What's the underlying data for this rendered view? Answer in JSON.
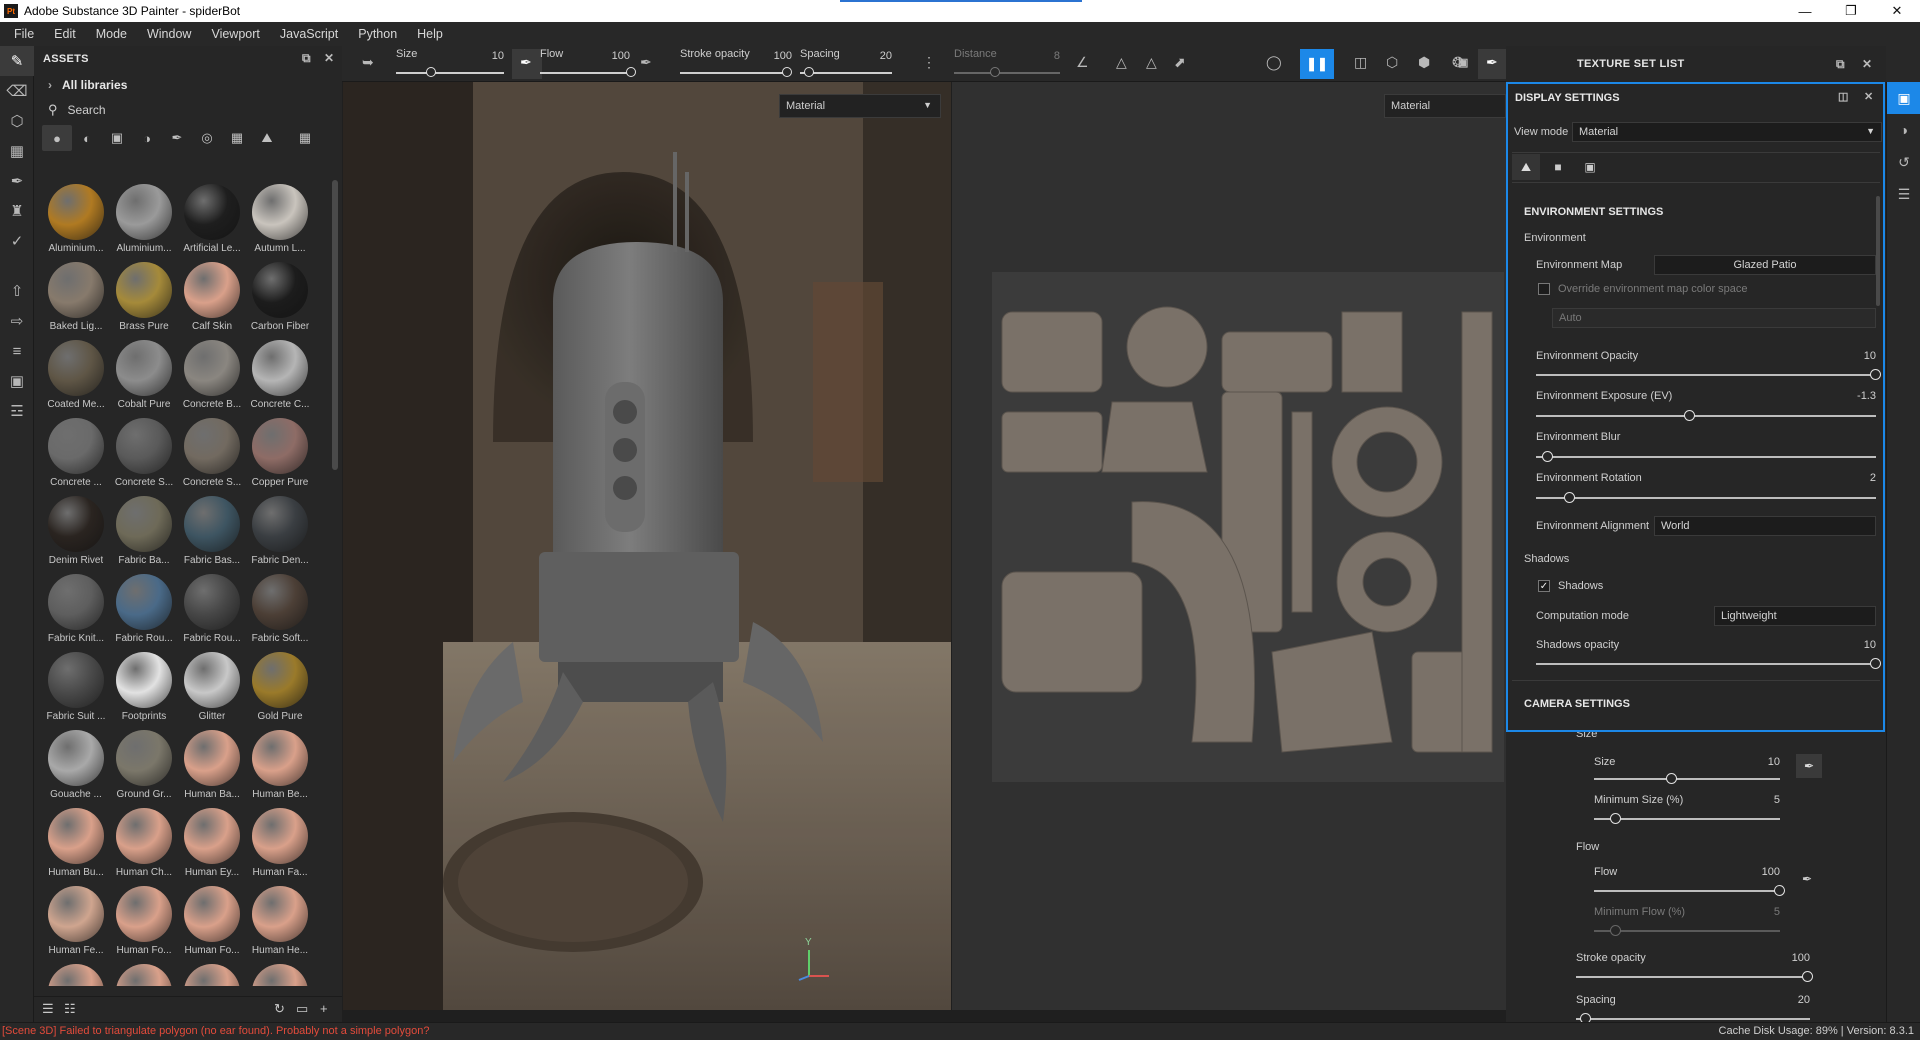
{
  "app": {
    "title": "Adobe Substance 3D Painter - spiderBot",
    "logo_text": "Pt"
  },
  "menu": [
    "File",
    "Edit",
    "Mode",
    "Window",
    "Viewport",
    "JavaScript",
    "Python",
    "Help"
  ],
  "assets": {
    "header": "ASSETS",
    "libraries_label": "All libraries",
    "search_placeholder": "Search",
    "items": [
      {
        "label": "Aluminium...",
        "color": "#b07a22"
      },
      {
        "label": "Aluminium...",
        "color": "#9a9a9a"
      },
      {
        "label": "Artificial Le...",
        "color": "#1e1e1e"
      },
      {
        "label": "Autumn L...",
        "color": "#c9c4bd"
      },
      {
        "label": "Baked Lig...",
        "color": "#877a6c"
      },
      {
        "label": "Brass Pure",
        "color": "#a58a3a"
      },
      {
        "label": "Calf Skin",
        "color": "#d9a08a"
      },
      {
        "label": "Carbon Fiber",
        "color": "#1c1c1c"
      },
      {
        "label": "Coated Me...",
        "color": "#5f5646"
      },
      {
        "label": "Cobalt Pure",
        "color": "#8c8c8c"
      },
      {
        "label": "Concrete B...",
        "color": "#8a8680"
      },
      {
        "label": "Concrete C...",
        "color": "#b5b5b5"
      },
      {
        "label": "Concrete ...",
        "color": "#6a6a6a"
      },
      {
        "label": "Concrete S...",
        "color": "#5a5a5a"
      },
      {
        "label": "Concrete S...",
        "color": "#726a60"
      },
      {
        "label": "Copper Pure",
        "color": "#8e6c66"
      },
      {
        "label": "Denim Rivet",
        "color": "#2a2420"
      },
      {
        "label": "Fabric Ba...",
        "color": "#6e6a58"
      },
      {
        "label": "Fabric Bas...",
        "color": "#3e5562"
      },
      {
        "label": "Fabric Den...",
        "color": "#3a3e42"
      },
      {
        "label": "Fabric Knit...",
        "color": "#5e5e5e"
      },
      {
        "label": "Fabric Rou...",
        "color": "#4a6a88"
      },
      {
        "label": "Fabric Rou...",
        "color": "#474747"
      },
      {
        "label": "Fabric Soft...",
        "color": "#4c3f36"
      },
      {
        "label": "Fabric Suit ...",
        "color": "#4a4a4a"
      },
      {
        "label": "Footprints",
        "color": "#e2e2e2"
      },
      {
        "label": "Glitter",
        "color": "#c8c8c8"
      },
      {
        "label": "Gold Pure",
        "color": "#9a7a2a"
      },
      {
        "label": "Gouache ...",
        "color": "#a9a9a9"
      },
      {
        "label": "Ground Gr...",
        "color": "#7b776a"
      },
      {
        "label": "Human Ba...",
        "color": "#d9a08a"
      },
      {
        "label": "Human Be...",
        "color": "#d9a08a"
      },
      {
        "label": "Human Bu...",
        "color": "#d9a08a"
      },
      {
        "label": "Human Ch...",
        "color": "#d9a08a"
      },
      {
        "label": "Human Ey...",
        "color": "#d9a08a"
      },
      {
        "label": "Human Fa...",
        "color": "#d9a08a"
      },
      {
        "label": "Human Fe...",
        "color": "#cfa58f"
      },
      {
        "label": "Human Fo...",
        "color": "#d9a08a"
      },
      {
        "label": "Human Fo...",
        "color": "#d9a08a"
      },
      {
        "label": "Human He...",
        "color": "#d9a08a"
      },
      {
        "label": "",
        "color": "#d9a08a"
      },
      {
        "label": "",
        "color": "#d9a08a"
      },
      {
        "label": "",
        "color": "#d9a08a"
      },
      {
        "label": "",
        "color": "#d9a08a"
      }
    ]
  },
  "toolbar": {
    "size_label": "Size",
    "size_value": "10",
    "flow_label": "Flow",
    "flow_value": "100",
    "stroke_label": "Stroke opacity",
    "stroke_value": "100",
    "spacing_label": "Spacing",
    "spacing_value": "20",
    "distance_label": "Distance",
    "distance_value": "8"
  },
  "viewport": {
    "left_mode": "Material",
    "right_mode": "Material",
    "axis_y": "Y",
    "axis_u": "U"
  },
  "texture_set": {
    "header": "TEXTURE SET LIST"
  },
  "display_settings": {
    "header": "DISPLAY SETTINGS",
    "view_mode_label": "View mode",
    "view_mode_value": "Material",
    "env_section": "ENVIRONMENT SETTINGS",
    "environment_label": "Environment",
    "env_map_label": "Environment Map",
    "env_map_value": "Glazed Patio",
    "override_label": "Override environment map color space",
    "auto_value": "Auto",
    "env_opacity_label": "Environment Opacity",
    "env_opacity_value": "10",
    "env_exposure_label": "Environment Exposure (EV)",
    "env_exposure_value": "-1.3",
    "env_blur_label": "Environment Blur",
    "env_rotation_label": "Environment Rotation",
    "env_rotation_value": "2",
    "env_alignment_label": "Environment Alignment",
    "env_alignment_value": "World",
    "shadows_group": "Shadows",
    "shadows_check_label": "Shadows",
    "computation_label": "Computation mode",
    "computation_value": "Lightweight",
    "shadows_opacity_label": "Shadows opacity",
    "shadows_opacity_value": "10",
    "camera_section": "CAMERA SETTINGS"
  },
  "brush_props": {
    "size_group": "Size",
    "size_label": "Size",
    "size_value": "10",
    "min_size_label": "Minimum Size (%)",
    "min_size_value": "5",
    "flow_group": "Flow",
    "flow_label": "Flow",
    "flow_value": "100",
    "min_flow_label": "Minimum Flow (%)",
    "min_flow_value": "5",
    "stroke_label": "Stroke opacity",
    "stroke_value": "100",
    "spacing_label": "Spacing",
    "spacing_value": "20"
  },
  "status": {
    "error": "[Scene 3D] Failed to triangulate polygon (no ear found). Probably not a simple polygon?",
    "right": "Cache Disk Usage:   89% | Version: 8.3.1"
  },
  "colors": {
    "accent": "#1c88e8",
    "error": "#e34b3b",
    "panel_bg": "#262626"
  }
}
